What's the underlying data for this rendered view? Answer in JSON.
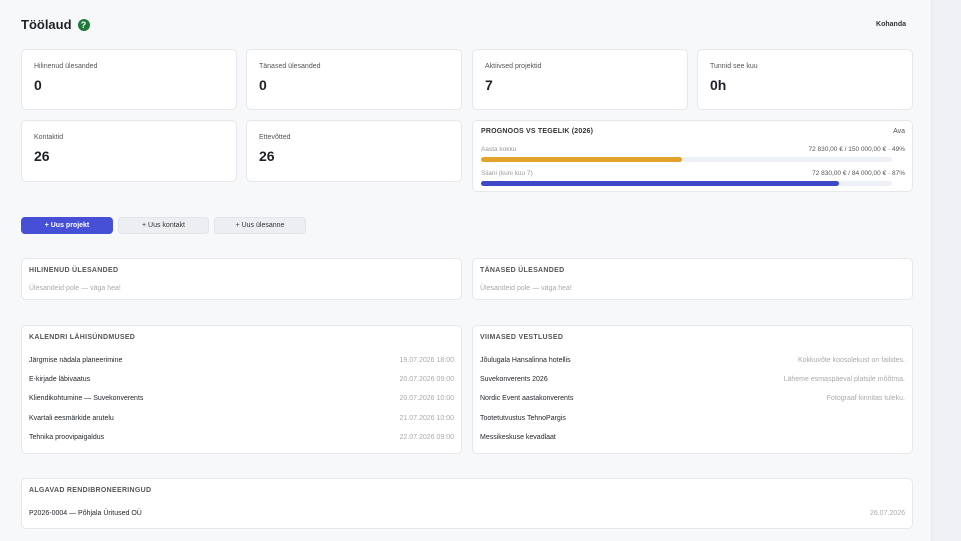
{
  "header": {
    "title": "Töölaud",
    "help_icon": "?",
    "customize_label": "Kohanda"
  },
  "stats": [
    {
      "label": "Hilinenud ülesanded",
      "value": "0"
    },
    {
      "label": "Tänased ülesanded",
      "value": "0"
    },
    {
      "label": "Aktiivsed projektid",
      "value": "7"
    },
    {
      "label": "Tunnid see kuu",
      "value": "0h"
    },
    {
      "label": "Kontaktid",
      "value": "26"
    },
    {
      "label": "Ettevõtted",
      "value": "26"
    }
  ],
  "forecast": {
    "title": "PROGNOOS VS TEGELIK (2026)",
    "open_label": "Ava",
    "rows": [
      {
        "label": "Aasta kokku",
        "value": "72 830,00 € / 150 000,00 € · 49%",
        "fraction": 0.49,
        "color": "#e2a32b"
      },
      {
        "label": "Siiani (kuni kuu 7)",
        "value": "72 830,00 € / 84 000,00 € · 87%",
        "fraction": 0.87,
        "color": "#3f49c8"
      }
    ]
  },
  "actions": {
    "new_project": "+ Uus projekt",
    "new_contact": "+ Uus kontakt",
    "new_task": "+ Uus ülesanne"
  },
  "late_tasks": {
    "title": "HILINENUD ÜLESANDED",
    "empty": "Ülesandeid pole — väga hea!"
  },
  "today_tasks": {
    "title": "TÄNASED ÜLESANDED",
    "empty": "Ülesandeid pole — väga hea!"
  },
  "calendar": {
    "title": "KALENDRI LÄHISÜNDMUSED",
    "items": [
      {
        "name": "Järgmise nädala planeerimine",
        "date": "19.07.2026 18:00"
      },
      {
        "name": "E-kirjade läbivaatus",
        "date": "20.07.2026 09:00"
      },
      {
        "name": "Kliendikohtumine — Suvekonverents",
        "date": "20.07.2026 10:00"
      },
      {
        "name": "Kvartali eesmärkide arutelu",
        "date": "21.07.2026 10:00"
      },
      {
        "name": "Tehnika proovipaigaldus",
        "date": "22.07.2026 09:00"
      }
    ]
  },
  "conversations": {
    "title": "VIIMASED VESTLUSED",
    "items": [
      {
        "name": "Jõulugala Hansalinna hotellis",
        "note": "Kokkuvõte koosolekust on failides."
      },
      {
        "name": "Suvekonverents 2026",
        "note": "Läheme esmaspäeval platsile mõõtma."
      },
      {
        "name": "Nordic Event aastakonverents",
        "note": "Fotograaf kinnitas tuleku."
      },
      {
        "name": "Tootetutvustus TehnoPargis",
        "note": ""
      },
      {
        "name": "Messikeskuse kevadlaat",
        "note": ""
      }
    ]
  },
  "rentals": {
    "title": "ALGAVAD RENDIBRONEERINGUD",
    "items": [
      {
        "name": "P2026-0004 — Põhjala Üritused OÜ",
        "date": "26.07.2026"
      }
    ]
  }
}
